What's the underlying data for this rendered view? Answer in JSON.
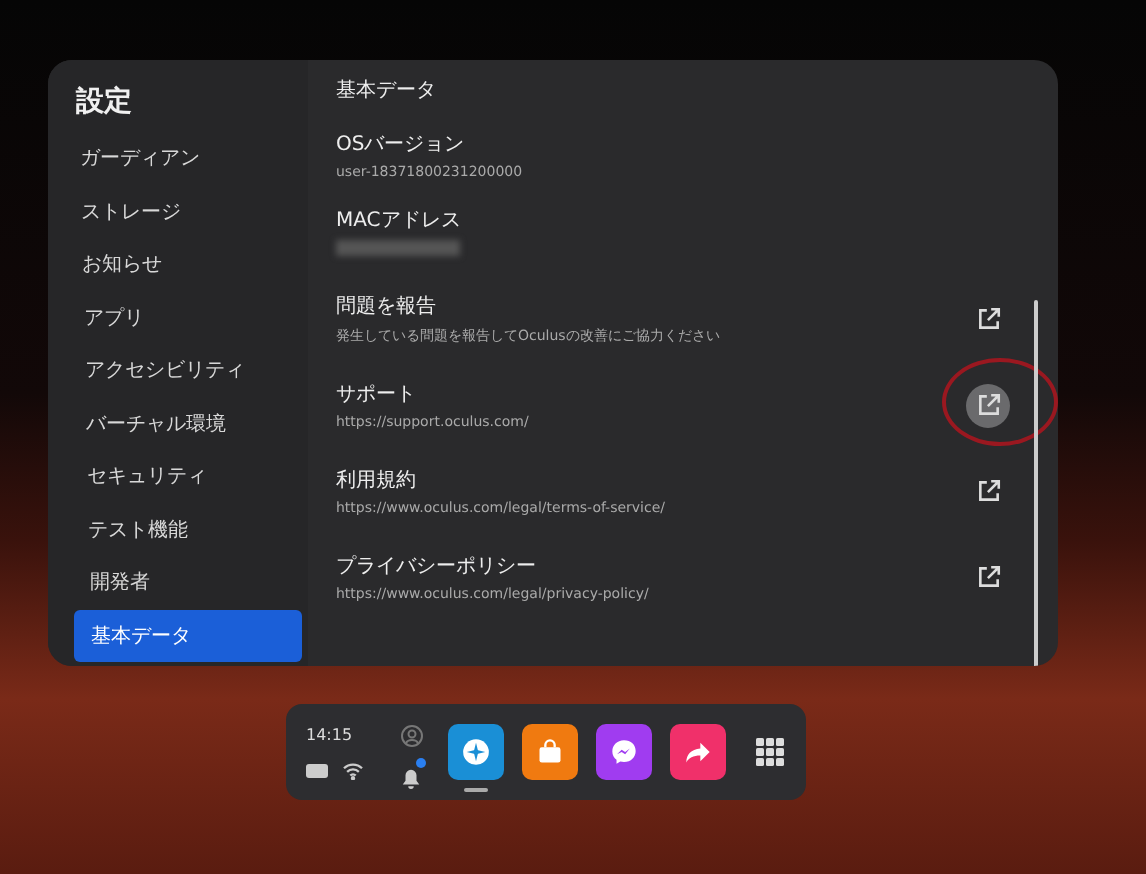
{
  "sidebar": {
    "title": "設定",
    "items": [
      {
        "label": "ガーディアン",
        "selected": false
      },
      {
        "label": "ストレージ",
        "selected": false
      },
      {
        "label": "お知らせ",
        "selected": false
      },
      {
        "label": "アプリ",
        "selected": false
      },
      {
        "label": "アクセシビリティ",
        "selected": false
      },
      {
        "label": "バーチャル環境",
        "selected": false
      },
      {
        "label": "セキュリティ",
        "selected": false
      },
      {
        "label": "テスト機能",
        "selected": false
      },
      {
        "label": "開発者",
        "selected": false
      },
      {
        "label": "基本データ",
        "selected": true
      }
    ]
  },
  "content": {
    "title": "基本データ",
    "rows": [
      {
        "kind": "info",
        "title": "OSバージョン",
        "value": "user-18371800231200000"
      },
      {
        "kind": "hidden",
        "title": "MACアドレス"
      },
      {
        "kind": "link",
        "title": "問題を報告",
        "subtitle": "発生している問題を報告してOculusの改善にご協力ください",
        "highlighted": false,
        "circled": false
      },
      {
        "kind": "link",
        "title": "サポート",
        "subtitle": "https://support.oculus.com/",
        "highlighted": true,
        "circled": true
      },
      {
        "kind": "link",
        "title": "利用規約",
        "subtitle": "https://www.oculus.com/legal/terms-of-service/",
        "highlighted": false,
        "circled": false
      },
      {
        "kind": "link",
        "title": "プライバシーポリシー",
        "subtitle": "https://www.oculus.com/legal/privacy-policy/",
        "highlighted": false,
        "circled": false
      }
    ]
  },
  "dock": {
    "time": "14:15",
    "notification": true,
    "apps": [
      {
        "kind": "explore",
        "color": "#1a8fd6",
        "selected": true
      },
      {
        "kind": "store",
        "color": "#f07a10",
        "selected": false
      },
      {
        "kind": "messenger",
        "color": "#a03cf0",
        "selected": false
      },
      {
        "kind": "share",
        "color": "#f0306a",
        "selected": false
      }
    ]
  }
}
